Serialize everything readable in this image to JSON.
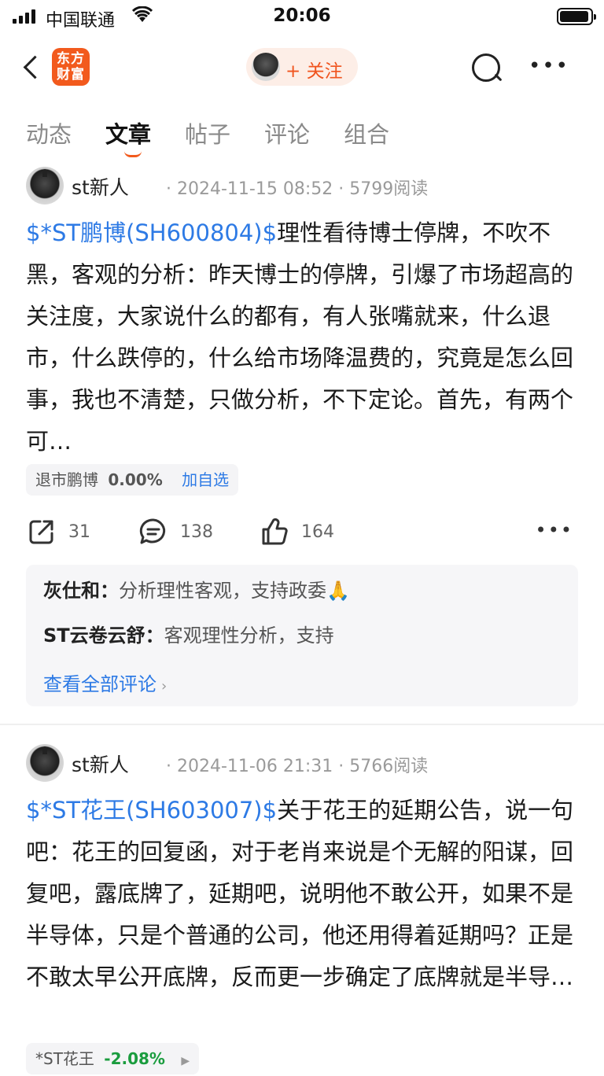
{
  "status_bar": {
    "carrier": "中国联通",
    "time": "20:06"
  },
  "nav": {
    "logo_text_line1": "东方",
    "logo_text_line2": "财富",
    "follow_label": "+ 关注"
  },
  "tabs": [
    {
      "label": "动态",
      "active": false
    },
    {
      "label": "文章",
      "active": true
    },
    {
      "label": "帖子",
      "active": false
    },
    {
      "label": "评论",
      "active": false
    },
    {
      "label": "组合",
      "active": false
    }
  ],
  "posts": [
    {
      "author": "st新人",
      "meta": "· 2024-11-15 08:52 · 5799阅读",
      "stock_link": "$*ST鹏博(SH600804)$",
      "body": "理性看待博士停牌，不吹不黑，客观的分析：昨天博士的停牌，引爆了市场超高的关注度，大家说什么的都有，有人张嘴就来，什么退市，什么跌停的，什么给市场降温费的，究竟是怎么回事，我也不清楚，只做分析，不下定论。首先，有两个可…",
      "tag": {
        "name": "退市鹏博",
        "change": "0.00%",
        "add": "加自选"
      },
      "shares": "31",
      "comments_count": "138",
      "likes": "164",
      "comments": [
        {
          "user": "灰仕和：",
          "text": "分析理性客观，支持政委🙏"
        },
        {
          "user": "ST云卷云舒：",
          "text": "客观理性分析，支持"
        }
      ],
      "view_all": "查看全部评论"
    },
    {
      "author": "st新人",
      "meta": "· 2024-11-06 21:31 · 5766阅读",
      "stock_link": "$*ST花王(SH603007)$",
      "body": "关于花王的延期公告，说一句吧：花王的回复函，对于老肖来说是个无解的阳谋，回复吧，露底牌了，延期吧，说明他不敢公开，如果不是半导体，只是个普通的公司，他还用得着延期吗？正是不敢太早公开底牌，反而更一步确定了底牌就是半导…",
      "tag": {
        "name": "*ST花王",
        "change": "-2.08%"
      }
    }
  ]
}
